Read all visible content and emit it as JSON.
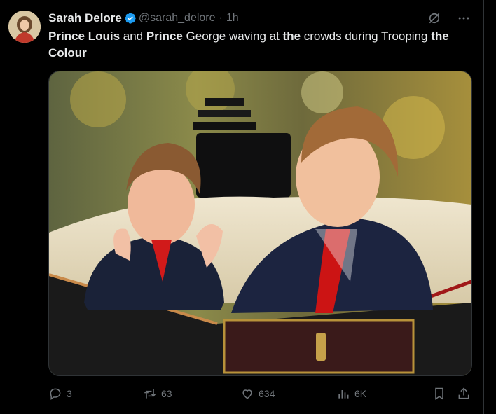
{
  "tweet": {
    "author_name": "Sarah Delore",
    "handle": "@sarah_delore",
    "separator": "·",
    "time": "1h",
    "text_parts": [
      {
        "t": "Prince Louis",
        "bold": true
      },
      {
        "t": " and ",
        "bold": false
      },
      {
        "t": "Prince",
        "bold": true
      },
      {
        "t": " George waving at ",
        "bold": false
      },
      {
        "t": "the",
        "bold": true
      },
      {
        "t": " crowds during Trooping ",
        "bold": false
      },
      {
        "t": "the Colour",
        "bold": true
      }
    ]
  },
  "icons": {
    "verified": "verified-badge-icon",
    "grok": "grok-icon",
    "more": "more-icon",
    "reply": "reply-icon",
    "retweet": "retweet-icon",
    "like": "heart-icon",
    "views": "views-icon",
    "bookmark": "bookmark-icon",
    "share": "share-icon"
  },
  "stats": {
    "replies": "3",
    "retweets": "63",
    "likes": "634",
    "views": "6K"
  },
  "colors": {
    "background": "#000000",
    "text": "#e7e9ea",
    "muted": "#71767b",
    "verified": "#1d9bf0",
    "border": "#2f3336"
  }
}
